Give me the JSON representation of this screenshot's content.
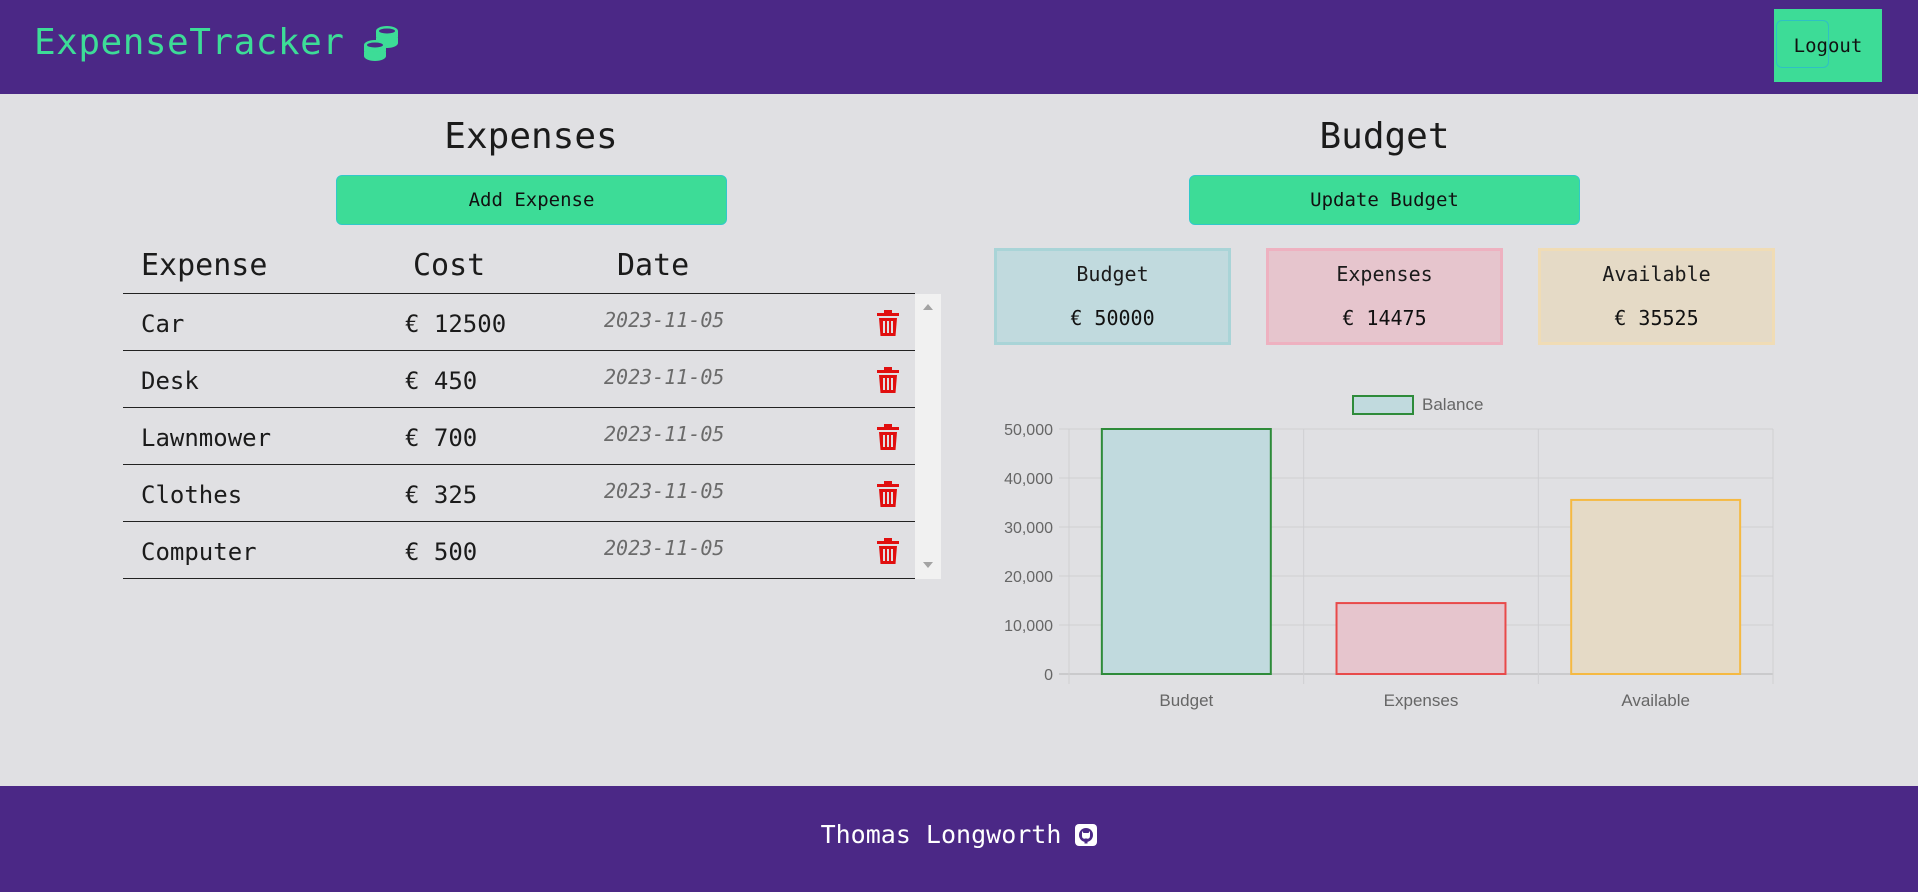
{
  "header": {
    "brand": "ExpenseTracker",
    "logout_label": "Logout"
  },
  "expenses": {
    "title": "Expenses",
    "add_label": "Add Expense",
    "columns": [
      "Expense",
      "Cost",
      "Date"
    ],
    "rows": [
      {
        "name": "Car",
        "cost": "€ 12500",
        "date": "2023-11-05"
      },
      {
        "name": "Desk",
        "cost": "€ 450",
        "date": "2023-11-05"
      },
      {
        "name": "Lawnmower",
        "cost": "€ 700",
        "date": "2023-11-05"
      },
      {
        "name": "Clothes",
        "cost": "€ 325",
        "date": "2023-11-05"
      },
      {
        "name": "Computer",
        "cost": "€ 500",
        "date": "2023-11-05"
      }
    ]
  },
  "budget": {
    "title": "Budget",
    "update_label": "Update Budget",
    "cards": [
      {
        "label": "Budget",
        "value": "€ 50000",
        "bg": "#c1dade",
        "border": "#a9d4d7"
      },
      {
        "label": "Expenses",
        "value": "€ 14475",
        "bg": "#e6c5cd",
        "border": "#eeb1c0"
      },
      {
        "label": "Available",
        "value": "€ 35525",
        "bg": "#e5dac6",
        "border": "#f0dcb5"
      }
    ]
  },
  "chart_data": {
    "type": "bar",
    "categories": [
      "Budget",
      "Expenses",
      "Available"
    ],
    "series": [
      {
        "name": "Balance",
        "values": [
          50000,
          14475,
          35525
        ]
      }
    ],
    "bar_colors": [
      "#2e8b3a",
      "#e84a4a",
      "#f5b942"
    ],
    "bar_fills": [
      "#c1dade",
      "#e6c5cd",
      "#e5dac6"
    ],
    "ylim": [
      0,
      50000
    ],
    "yticks": [
      "0",
      "10,000",
      "20,000",
      "30,000",
      "40,000",
      "50,000"
    ],
    "grid": true,
    "legend": "top"
  },
  "footer": {
    "author": "Thomas Longworth"
  },
  "colors": {
    "purple": "#4b2886",
    "green": "#3ddc97",
    "trash": "#e10f0f"
  }
}
